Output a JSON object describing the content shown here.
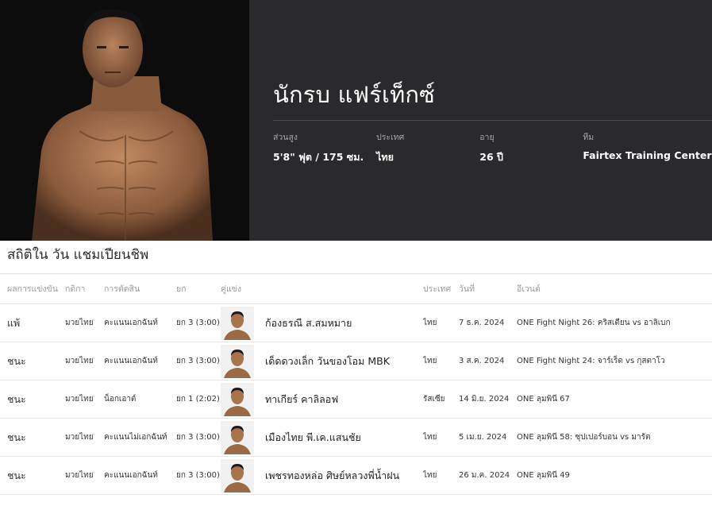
{
  "fighter": {
    "name": "นักรบ แฟร์เท็กซ์",
    "stats": [
      {
        "label": "ส่วนสูง",
        "value": "5'8\" ฟุต / 175 ซม."
      },
      {
        "label": "ประเทศ",
        "value": "ไทย"
      },
      {
        "label": "อายุ",
        "value": "26 ปี"
      },
      {
        "label": "ทีม",
        "value": "Fairtex Training Center"
      }
    ]
  },
  "section": {
    "title": "สถิติใน วัน แชมเปียนชิพ"
  },
  "table": {
    "headers": {
      "result": "ผลการแข่งขัน",
      "rules": "กติกา",
      "method": "การตัดสิน",
      "round": "ยก",
      "opponent": "คู่แข่ง",
      "country": "ประเทศ",
      "date": "วันที่",
      "event": "อีเวนต์"
    },
    "rows": [
      {
        "result": "แพ้",
        "outcome": "loss",
        "rules": "มวยไทย",
        "method": "คะแนนเอกฉันท์",
        "round": "ยก 3 (3:00)",
        "opponent": "ก้องธรณี ส.สมหมาย",
        "country": "ไทย",
        "date": "7 ธ.ค. 2024",
        "event": "ONE Fight Night 26: คริสเตียน vs อาลิเบก"
      },
      {
        "result": "ชนะ",
        "outcome": "win",
        "rules": "มวยไทย",
        "method": "คะแนนเอกฉันท์",
        "round": "ยก 3 (3:00)",
        "opponent": "เด็ดดวงเล็ก วันของโอม MBK",
        "country": "ไทย",
        "date": "3 ส.ค. 2024",
        "event": "ONE Fight Night 24: จาร์เร็ด vs กุสตาโว"
      },
      {
        "result": "ชนะ",
        "outcome": "win",
        "rules": "มวยไทย",
        "method": "น็อกเอาต์",
        "round": "ยก 1 (2:02)",
        "opponent": "ทาเกียร์ คาลิลอฟ",
        "country": "รัสเซีย",
        "date": "14 มิ.ย. 2024",
        "event": "ONE ลุมพินี 67"
      },
      {
        "result": "ชนะ",
        "outcome": "win",
        "rules": "มวยไทย",
        "method": "คะแนนไม่เอกฉันท์",
        "round": "ยก 3 (3:00)",
        "opponent": "เมืองไทย พี.เค.แสนชัย",
        "country": "ไทย",
        "date": "5 เม.ย. 2024",
        "event": "ONE ลุมพินี 58: ซุปเปอร์บอน vs มารัต"
      },
      {
        "result": "ชนะ",
        "outcome": "win",
        "rules": "มวยไทย",
        "method": "คะแนนเอกฉันท์",
        "round": "ยก 3 (3:00)",
        "opponent": "เพชรทองหล่อ ศิษย์หลวงพี่น้ำฝน",
        "country": "ไทย",
        "date": "26 ม.ค. 2024",
        "event": "ONE ลุมพินี 49"
      }
    ]
  },
  "colors": {
    "win": "#2a9d2a",
    "loss": "#e02a2a",
    "hero_bg": "#2a2a2c"
  }
}
